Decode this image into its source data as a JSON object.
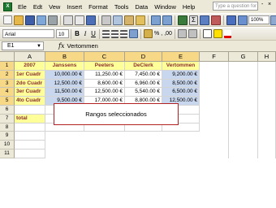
{
  "menu": {
    "items": [
      "Ele",
      "Edt",
      "Vew",
      "Insert",
      "Format",
      "Tools",
      "Data",
      "Window",
      "Help"
    ],
    "help_placeholder": "Type a question for help",
    "ctrl_min": "-",
    "ctrl_close": "×"
  },
  "toolbar": {
    "font_name": "Arial",
    "font_size": "10",
    "bold_label": "B",
    "italic_label": "I",
    "underline_label": "U",
    "percent_label": "%",
    "comma_label": ",",
    "dec_label": ",00",
    "zoom": "100%"
  },
  "formula_bar": {
    "cell_ref": "E1",
    "fx_label": "fx",
    "content": "Vertommen"
  },
  "grid": {
    "columns": [
      "A",
      "B",
      "C",
      "D",
      "E",
      "F",
      "G",
      "H"
    ],
    "rows": [
      "1",
      "2",
      "3",
      "4",
      "5",
      "6",
      "7",
      "8",
      "9",
      "10",
      "11"
    ],
    "header_row": [
      "2007",
      "Janssens",
      "Peeters",
      "DeClerk",
      "Vertommen"
    ],
    "data": [
      [
        "1er Cuadr",
        "10,000.00 €",
        "11,250.00 €",
        "7,450.00 €",
        "9,200.00 €"
      ],
      [
        "2do Cuadr",
        "12,500.00 €",
        "8,600.00 €",
        "6,960.00 €",
        "8,500.00 €"
      ],
      [
        "3er Cuadr",
        "11,500.00 €",
        "12,500.00 €",
        "5,540.00 €",
        "6,500.00 €"
      ],
      [
        "4to Cuadr",
        "9,500.00 €",
        "17,000.00 €",
        "8,800.00 €",
        "12,500.00 €"
      ]
    ],
    "total_label": "total"
  },
  "annotation": "Rangos seleccionados",
  "colors": {
    "selection_blue": "#c9d7ee",
    "label_yellow": "#ffff99",
    "annotation_border": "#b22222"
  }
}
